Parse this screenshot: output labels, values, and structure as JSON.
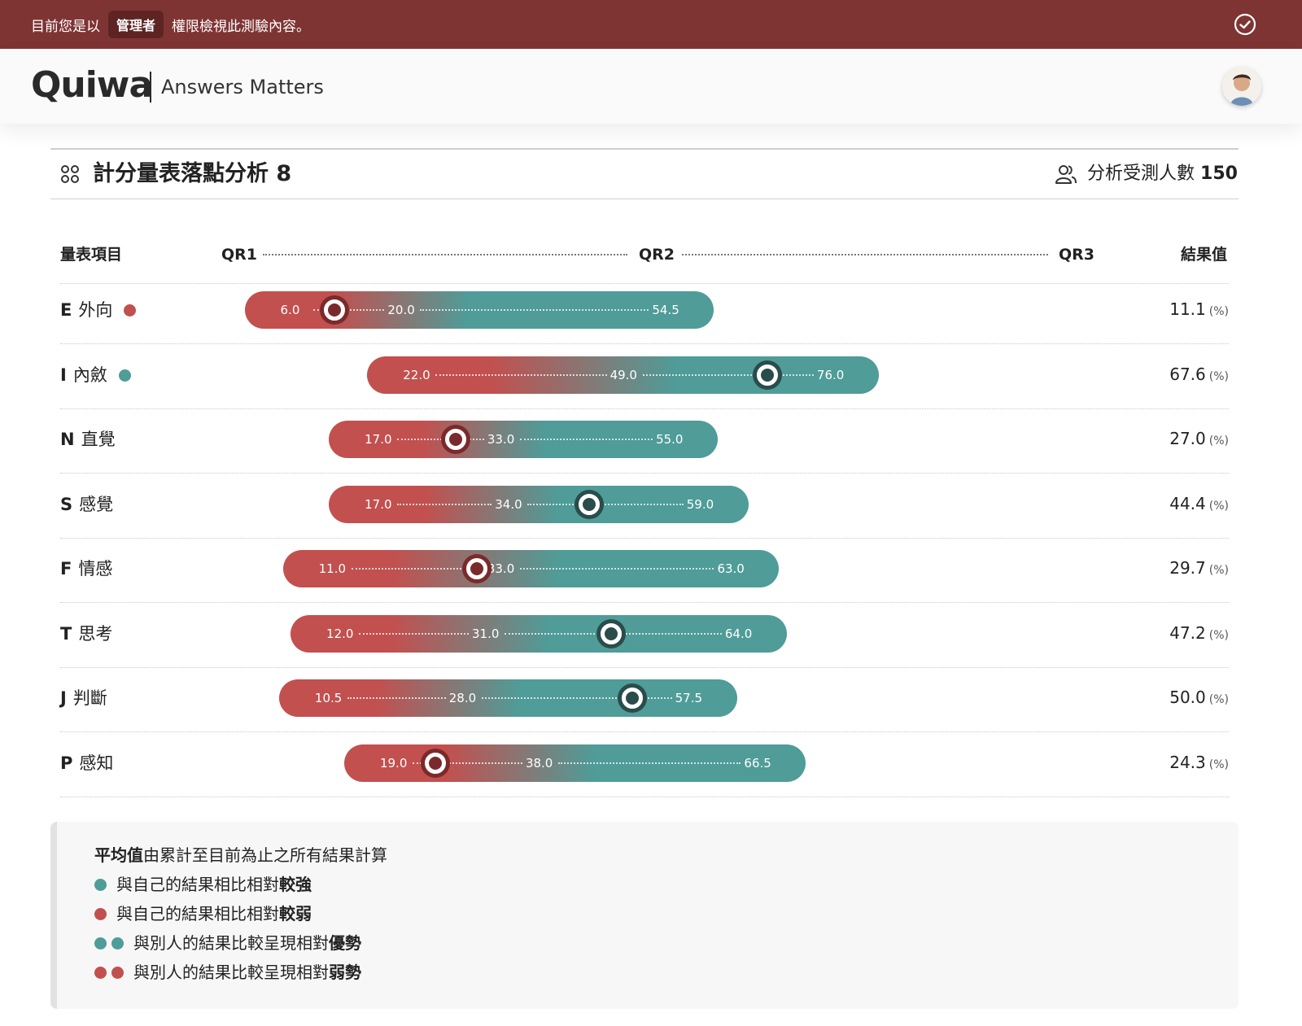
{
  "admin_banner": {
    "prefix": "目前您是以",
    "role": "管理者",
    "suffix": "權限檢視此測驗內容。"
  },
  "header": {
    "logo": "Quiwa",
    "tagline": "Answers Matters"
  },
  "section": {
    "title": "計分量表落點分析 8",
    "participants_label": "分析受測人數",
    "participants_count": "150"
  },
  "columns": {
    "item": "量表項目",
    "qr1": "QR1",
    "qr2": "QR2",
    "qr3": "QR3",
    "result": "結果值"
  },
  "colors": {
    "red": "#c2504f",
    "teal": "#4f9c98",
    "banner": "#7f3434",
    "marker_red": "#7a2a2a",
    "marker_teal": "#2a4c4a"
  },
  "rows": [
    {
      "code": "E",
      "name": "外向",
      "dot": "red",
      "q1": "6.0",
      "q2": "20.0",
      "q3": "54.5",
      "value": "11.1",
      "unit": "(%)",
      "q1n": 6.0,
      "q2n": 20.0,
      "q3n": 54.5,
      "vn": 11.1
    },
    {
      "code": "I",
      "name": "內斂",
      "dot": "teal",
      "q1": "22.0",
      "q2": "49.0",
      "q3": "76.0",
      "value": "67.6",
      "unit": "(%)",
      "q1n": 22.0,
      "q2n": 49.0,
      "q3n": 76.0,
      "vn": 67.6
    },
    {
      "code": "N",
      "name": "直覺",
      "dot": "",
      "q1": "17.0",
      "q2": "33.0",
      "q3": "55.0",
      "value": "27.0",
      "unit": "(%)",
      "q1n": 17.0,
      "q2n": 33.0,
      "q3n": 55.0,
      "vn": 27.0
    },
    {
      "code": "S",
      "name": "感覺",
      "dot": "",
      "q1": "17.0",
      "q2": "34.0",
      "q3": "59.0",
      "value": "44.4",
      "unit": "(%)",
      "q1n": 17.0,
      "q2n": 34.0,
      "q3n": 59.0,
      "vn": 44.4
    },
    {
      "code": "F",
      "name": "情感",
      "dot": "",
      "q1": "11.0",
      "q2": "33.0",
      "q3": "63.0",
      "value": "29.7",
      "unit": "(%)",
      "q1n": 11.0,
      "q2n": 33.0,
      "q3n": 63.0,
      "vn": 29.7
    },
    {
      "code": "T",
      "name": "思考",
      "dot": "",
      "q1": "12.0",
      "q2": "31.0",
      "q3": "64.0",
      "value": "47.2",
      "unit": "(%)",
      "q1n": 12.0,
      "q2n": 31.0,
      "q3n": 64.0,
      "vn": 47.2
    },
    {
      "code": "J",
      "name": "判斷",
      "dot": "",
      "q1": "10.5",
      "q2": "28.0",
      "q3": "57.5",
      "value": "50.0",
      "unit": "(%)",
      "q1n": 10.5,
      "q2n": 28.0,
      "q3n": 57.5,
      "vn": 50.0
    },
    {
      "code": "P",
      "name": "感知",
      "dot": "",
      "q1": "19.0",
      "q2": "38.0",
      "q3": "66.5",
      "value": "24.3",
      "unit": "(%)",
      "q1n": 19.0,
      "q2n": 38.0,
      "q3n": 66.5,
      "vn": 24.3
    }
  ],
  "legend": {
    "title_bold": "平均值",
    "title_rest": "由累計至目前為止之所有結果計算",
    "items": [
      {
        "dots": [
          "teal"
        ],
        "text": "與自己的結果相比相對",
        "bold": "較強"
      },
      {
        "dots": [
          "red"
        ],
        "text": "與自己的結果相比相對",
        "bold": "較弱"
      },
      {
        "dots": [
          "teal",
          "teal"
        ],
        "text": "與別人的結果比較呈現相對",
        "bold": "優勢"
      },
      {
        "dots": [
          "red",
          "red"
        ],
        "text": "與別人的結果比較呈現相對",
        "bold": "弱勢"
      }
    ]
  }
}
